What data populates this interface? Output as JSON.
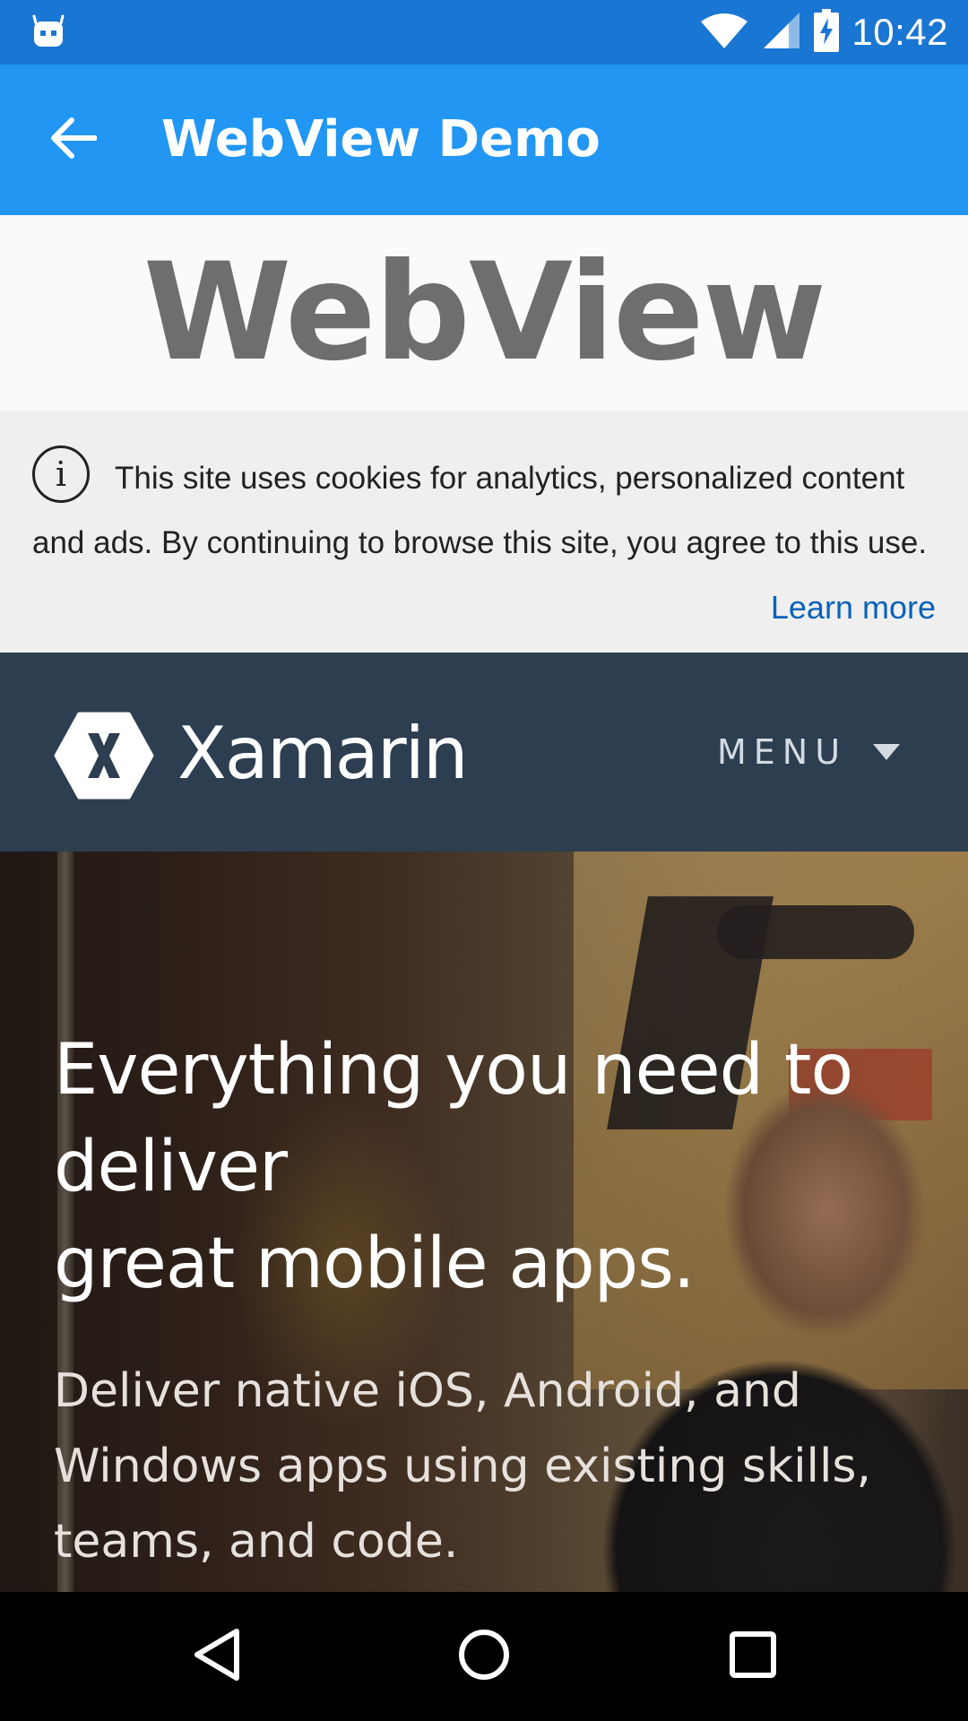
{
  "status_bar": {
    "time": "10:42",
    "icons": [
      "android-debug-icon",
      "wifi-icon",
      "cellular-signal-icon",
      "battery-charging-icon"
    ]
  },
  "app_bar": {
    "title": "WebView Demo",
    "back_icon": "arrow-back-icon",
    "color": "#2196F3"
  },
  "web_content": {
    "heading": "WebView",
    "cookie_banner": {
      "text": "This site uses cookies for analytics, personalized content and ads. By continuing to browse this site, you agree to this use.",
      "link": "Learn more",
      "icon": "info-icon"
    },
    "xamarin_nav": {
      "brand": "Xamarin",
      "menu_label": "MENU",
      "logo_icon": "xamarin-logo-icon",
      "caret_icon": "caret-down-icon",
      "color": "#2d3e50"
    },
    "hero": {
      "headline_line1": "Everything you need to",
      "headline_line2": "deliver",
      "headline_line3": "great mobile apps.",
      "subtext": "Deliver native iOS, Android, and Windows apps using existing skills, teams, and code."
    }
  },
  "nav_bar": {
    "buttons": [
      "back-triangle-icon",
      "home-circle-icon",
      "recents-square-icon"
    ]
  }
}
